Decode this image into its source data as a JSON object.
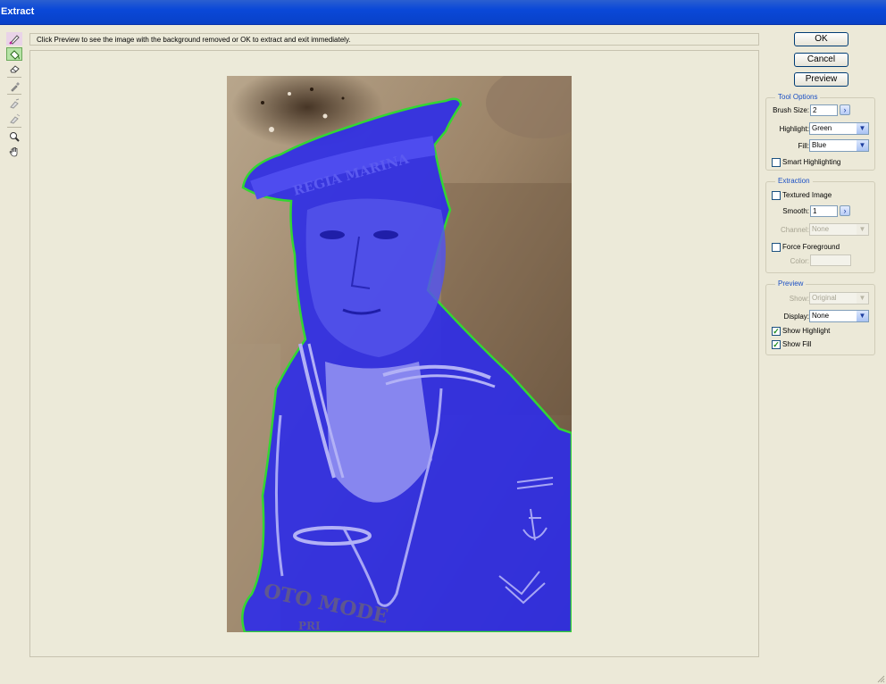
{
  "window": {
    "title": "Extract"
  },
  "hint": "Click Preview to see the image with the background removed or OK to extract and exit immediately.",
  "tools": [
    {
      "name": "edge-highlighter-icon"
    },
    {
      "name": "fill-bucket-icon"
    },
    {
      "name": "eraser-icon"
    },
    {
      "name": "eyedropper-icon"
    },
    {
      "name": "cleanup-icon"
    },
    {
      "name": "edge-touchup-icon"
    },
    {
      "name": "zoom-icon"
    },
    {
      "name": "hand-icon"
    }
  ],
  "buttons": {
    "ok": "OK",
    "cancel": "Cancel",
    "preview": "Preview"
  },
  "tool_options": {
    "title": "Tool Options",
    "brush_size_label": "Brush Size:",
    "brush_size_value": "2",
    "highlight_label": "Highlight:",
    "highlight_value": "Green",
    "fill_label": "Fill:",
    "fill_value": "Blue",
    "smart_highlighting_label": "Smart Highlighting",
    "smart_highlighting_checked": false
  },
  "extraction": {
    "title": "Extraction",
    "textured_image_label": "Textured Image",
    "textured_image_checked": false,
    "smooth_label": "Smooth:",
    "smooth_value": "1",
    "channel_label": "Channel:",
    "channel_value": "None",
    "force_foreground_label": "Force Foreground",
    "force_foreground_checked": false,
    "color_label": "Color:"
  },
  "preview": {
    "title": "Preview",
    "show_label": "Show:",
    "show_value": "Original",
    "display_label": "Display:",
    "display_value": "None",
    "show_highlight_label": "Show Highlight",
    "show_highlight_checked": true,
    "show_fill_label": "Show Fill",
    "show_fill_checked": true
  },
  "colors": {
    "highlight": "#33d633",
    "fill": "#2f2ee6",
    "accent": "#1a4fc4",
    "titlebar": "#0a48d8"
  },
  "image": {
    "text_on_cap": "REGIA MARINA",
    "studio_stamp_letters": "OTO MODE",
    "studio_stamp_city": "PRI"
  }
}
